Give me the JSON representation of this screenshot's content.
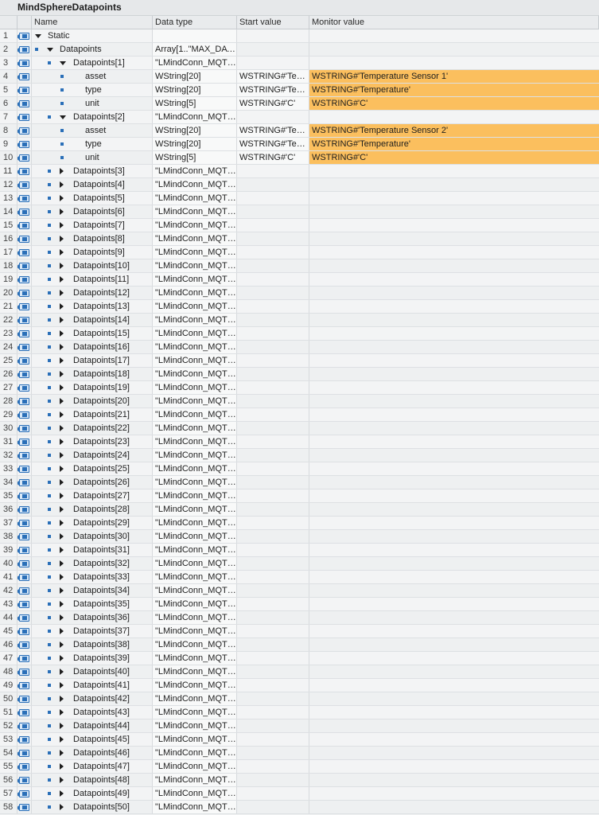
{
  "title": "MindSphereDatapoints",
  "columns": {
    "name": "Name",
    "type": "Data type",
    "start": "Start value",
    "monitor": "Monitor value"
  },
  "colors": {
    "monitor_highlight": "#fbbf5e",
    "icon_blue": "#2a6fb8"
  },
  "rows": [
    {
      "num": "1",
      "name": "Static",
      "type": "",
      "start": "",
      "monitor": "",
      "level": 0,
      "expand": "down",
      "bullet": false
    },
    {
      "num": "2",
      "name": "Datapoints",
      "type": "Array[1..\"MAX_DAT...",
      "start": "",
      "monitor": "",
      "level": 1,
      "expand": "down",
      "bullet": true
    },
    {
      "num": "3",
      "name": "Datapoints[1]",
      "type": "\"LMindConn_MQTT...",
      "start": "",
      "monitor": "",
      "level": 2,
      "expand": "down",
      "bullet": true
    },
    {
      "num": "4",
      "name": "asset",
      "type": "WString[20]",
      "start": "WSTRING#'Tem...",
      "monitor": "WSTRING#'Temperature Sensor 1'",
      "level": 3,
      "expand": "",
      "bullet": true
    },
    {
      "num": "5",
      "name": "type",
      "type": "WString[20]",
      "start": "WSTRING#'Tem...",
      "monitor": "WSTRING#'Temperature'",
      "level": 3,
      "expand": "",
      "bullet": true
    },
    {
      "num": "6",
      "name": "unit",
      "type": "WString[5]",
      "start": "WSTRING#'C'",
      "monitor": "WSTRING#'C'",
      "level": 3,
      "expand": "",
      "bullet": true
    },
    {
      "num": "7",
      "name": "Datapoints[2]",
      "type": "\"LMindConn_MQTT...",
      "start": "",
      "monitor": "",
      "level": 2,
      "expand": "down",
      "bullet": true
    },
    {
      "num": "8",
      "name": "asset",
      "type": "WString[20]",
      "start": "WSTRING#'Tem...",
      "monitor": "WSTRING#'Temperature Sensor 2'",
      "level": 3,
      "expand": "",
      "bullet": true
    },
    {
      "num": "9",
      "name": "type",
      "type": "WString[20]",
      "start": "WSTRING#'Tem...",
      "monitor": "WSTRING#'Temperature'",
      "level": 3,
      "expand": "",
      "bullet": true
    },
    {
      "num": "10",
      "name": "unit",
      "type": "WString[5]",
      "start": "WSTRING#'C'",
      "monitor": "WSTRING#'C'",
      "level": 3,
      "expand": "",
      "bullet": true
    },
    {
      "num": "11",
      "name": "Datapoints[3]",
      "type": "\"LMindConn_MQTT...",
      "start": "",
      "monitor": "",
      "level": 2,
      "expand": "right",
      "bullet": true
    },
    {
      "num": "12",
      "name": "Datapoints[4]",
      "type": "\"LMindConn_MQTT...",
      "start": "",
      "monitor": "",
      "level": 2,
      "expand": "right",
      "bullet": true
    },
    {
      "num": "13",
      "name": "Datapoints[5]",
      "type": "\"LMindConn_MQTT...",
      "start": "",
      "monitor": "",
      "level": 2,
      "expand": "right",
      "bullet": true
    },
    {
      "num": "14",
      "name": "Datapoints[6]",
      "type": "\"LMindConn_MQTT...",
      "start": "",
      "monitor": "",
      "level": 2,
      "expand": "right",
      "bullet": true
    },
    {
      "num": "15",
      "name": "Datapoints[7]",
      "type": "\"LMindConn_MQTT...",
      "start": "",
      "monitor": "",
      "level": 2,
      "expand": "right",
      "bullet": true
    },
    {
      "num": "16",
      "name": "Datapoints[8]",
      "type": "\"LMindConn_MQTT...",
      "start": "",
      "monitor": "",
      "level": 2,
      "expand": "right",
      "bullet": true
    },
    {
      "num": "17",
      "name": "Datapoints[9]",
      "type": "\"LMindConn_MQTT...",
      "start": "",
      "monitor": "",
      "level": 2,
      "expand": "right",
      "bullet": true
    },
    {
      "num": "18",
      "name": "Datapoints[10]",
      "type": "\"LMindConn_MQTT...",
      "start": "",
      "monitor": "",
      "level": 2,
      "expand": "right",
      "bullet": true
    },
    {
      "num": "19",
      "name": "Datapoints[11]",
      "type": "\"LMindConn_MQTT...",
      "start": "",
      "monitor": "",
      "level": 2,
      "expand": "right",
      "bullet": true
    },
    {
      "num": "20",
      "name": "Datapoints[12]",
      "type": "\"LMindConn_MQTT...",
      "start": "",
      "monitor": "",
      "level": 2,
      "expand": "right",
      "bullet": true
    },
    {
      "num": "21",
      "name": "Datapoints[13]",
      "type": "\"LMindConn_MQTT...",
      "start": "",
      "monitor": "",
      "level": 2,
      "expand": "right",
      "bullet": true
    },
    {
      "num": "22",
      "name": "Datapoints[14]",
      "type": "\"LMindConn_MQTT...",
      "start": "",
      "monitor": "",
      "level": 2,
      "expand": "right",
      "bullet": true
    },
    {
      "num": "23",
      "name": "Datapoints[15]",
      "type": "\"LMindConn_MQTT...",
      "start": "",
      "monitor": "",
      "level": 2,
      "expand": "right",
      "bullet": true
    },
    {
      "num": "24",
      "name": "Datapoints[16]",
      "type": "\"LMindConn_MQTT...",
      "start": "",
      "monitor": "",
      "level": 2,
      "expand": "right",
      "bullet": true
    },
    {
      "num": "25",
      "name": "Datapoints[17]",
      "type": "\"LMindConn_MQTT...",
      "start": "",
      "monitor": "",
      "level": 2,
      "expand": "right",
      "bullet": true
    },
    {
      "num": "26",
      "name": "Datapoints[18]",
      "type": "\"LMindConn_MQTT...",
      "start": "",
      "monitor": "",
      "level": 2,
      "expand": "right",
      "bullet": true
    },
    {
      "num": "27",
      "name": "Datapoints[19]",
      "type": "\"LMindConn_MQTT...",
      "start": "",
      "monitor": "",
      "level": 2,
      "expand": "right",
      "bullet": true
    },
    {
      "num": "28",
      "name": "Datapoints[20]",
      "type": "\"LMindConn_MQTT...",
      "start": "",
      "monitor": "",
      "level": 2,
      "expand": "right",
      "bullet": true
    },
    {
      "num": "29",
      "name": "Datapoints[21]",
      "type": "\"LMindConn_MQTT...",
      "start": "",
      "monitor": "",
      "level": 2,
      "expand": "right",
      "bullet": true
    },
    {
      "num": "30",
      "name": "Datapoints[22]",
      "type": "\"LMindConn_MQTT...",
      "start": "",
      "monitor": "",
      "level": 2,
      "expand": "right",
      "bullet": true
    },
    {
      "num": "31",
      "name": "Datapoints[23]",
      "type": "\"LMindConn_MQTT...",
      "start": "",
      "monitor": "",
      "level": 2,
      "expand": "right",
      "bullet": true
    },
    {
      "num": "32",
      "name": "Datapoints[24]",
      "type": "\"LMindConn_MQTT...",
      "start": "",
      "monitor": "",
      "level": 2,
      "expand": "right",
      "bullet": true
    },
    {
      "num": "33",
      "name": "Datapoints[25]",
      "type": "\"LMindConn_MQTT...",
      "start": "",
      "monitor": "",
      "level": 2,
      "expand": "right",
      "bullet": true
    },
    {
      "num": "34",
      "name": "Datapoints[26]",
      "type": "\"LMindConn_MQTT...",
      "start": "",
      "monitor": "",
      "level": 2,
      "expand": "right",
      "bullet": true
    },
    {
      "num": "35",
      "name": "Datapoints[27]",
      "type": "\"LMindConn_MQTT...",
      "start": "",
      "monitor": "",
      "level": 2,
      "expand": "right",
      "bullet": true
    },
    {
      "num": "36",
      "name": "Datapoints[28]",
      "type": "\"LMindConn_MQTT...",
      "start": "",
      "monitor": "",
      "level": 2,
      "expand": "right",
      "bullet": true
    },
    {
      "num": "37",
      "name": "Datapoints[29]",
      "type": "\"LMindConn_MQTT...",
      "start": "",
      "monitor": "",
      "level": 2,
      "expand": "right",
      "bullet": true
    },
    {
      "num": "38",
      "name": "Datapoints[30]",
      "type": "\"LMindConn_MQTT...",
      "start": "",
      "monitor": "",
      "level": 2,
      "expand": "right",
      "bullet": true
    },
    {
      "num": "39",
      "name": "Datapoints[31]",
      "type": "\"LMindConn_MQTT...",
      "start": "",
      "monitor": "",
      "level": 2,
      "expand": "right",
      "bullet": true
    },
    {
      "num": "40",
      "name": "Datapoints[32]",
      "type": "\"LMindConn_MQTT...",
      "start": "",
      "monitor": "",
      "level": 2,
      "expand": "right",
      "bullet": true
    },
    {
      "num": "41",
      "name": "Datapoints[33]",
      "type": "\"LMindConn_MQTT...",
      "start": "",
      "monitor": "",
      "level": 2,
      "expand": "right",
      "bullet": true
    },
    {
      "num": "42",
      "name": "Datapoints[34]",
      "type": "\"LMindConn_MQTT...",
      "start": "",
      "monitor": "",
      "level": 2,
      "expand": "right",
      "bullet": true
    },
    {
      "num": "43",
      "name": "Datapoints[35]",
      "type": "\"LMindConn_MQTT...",
      "start": "",
      "monitor": "",
      "level": 2,
      "expand": "right",
      "bullet": true
    },
    {
      "num": "44",
      "name": "Datapoints[36]",
      "type": "\"LMindConn_MQTT...",
      "start": "",
      "monitor": "",
      "level": 2,
      "expand": "right",
      "bullet": true
    },
    {
      "num": "45",
      "name": "Datapoints[37]",
      "type": "\"LMindConn_MQTT...",
      "start": "",
      "monitor": "",
      "level": 2,
      "expand": "right",
      "bullet": true
    },
    {
      "num": "46",
      "name": "Datapoints[38]",
      "type": "\"LMindConn_MQTT...",
      "start": "",
      "monitor": "",
      "level": 2,
      "expand": "right",
      "bullet": true
    },
    {
      "num": "47",
      "name": "Datapoints[39]",
      "type": "\"LMindConn_MQTT...",
      "start": "",
      "monitor": "",
      "level": 2,
      "expand": "right",
      "bullet": true
    },
    {
      "num": "48",
      "name": "Datapoints[40]",
      "type": "\"LMindConn_MQTT...",
      "start": "",
      "monitor": "",
      "level": 2,
      "expand": "right",
      "bullet": true
    },
    {
      "num": "49",
      "name": "Datapoints[41]",
      "type": "\"LMindConn_MQTT...",
      "start": "",
      "monitor": "",
      "level": 2,
      "expand": "right",
      "bullet": true
    },
    {
      "num": "50",
      "name": "Datapoints[42]",
      "type": "\"LMindConn_MQTT...",
      "start": "",
      "monitor": "",
      "level": 2,
      "expand": "right",
      "bullet": true
    },
    {
      "num": "51",
      "name": "Datapoints[43]",
      "type": "\"LMindConn_MQTT...",
      "start": "",
      "monitor": "",
      "level": 2,
      "expand": "right",
      "bullet": true
    },
    {
      "num": "52",
      "name": "Datapoints[44]",
      "type": "\"LMindConn_MQTT...",
      "start": "",
      "monitor": "",
      "level": 2,
      "expand": "right",
      "bullet": true
    },
    {
      "num": "53",
      "name": "Datapoints[45]",
      "type": "\"LMindConn_MQTT...",
      "start": "",
      "monitor": "",
      "level": 2,
      "expand": "right",
      "bullet": true
    },
    {
      "num": "54",
      "name": "Datapoints[46]",
      "type": "\"LMindConn_MQTT...",
      "start": "",
      "monitor": "",
      "level": 2,
      "expand": "right",
      "bullet": true
    },
    {
      "num": "55",
      "name": "Datapoints[47]",
      "type": "\"LMindConn_MQTT...",
      "start": "",
      "monitor": "",
      "level": 2,
      "expand": "right",
      "bullet": true
    },
    {
      "num": "56",
      "name": "Datapoints[48]",
      "type": "\"LMindConn_MQTT...",
      "start": "",
      "monitor": "",
      "level": 2,
      "expand": "right",
      "bullet": true
    },
    {
      "num": "57",
      "name": "Datapoints[49]",
      "type": "\"LMindConn_MQTT...",
      "start": "",
      "monitor": "",
      "level": 2,
      "expand": "right",
      "bullet": true
    },
    {
      "num": "58",
      "name": "Datapoints[50]",
      "type": "\"LMindConn_MQTT...",
      "start": "",
      "monitor": "",
      "level": 2,
      "expand": "right",
      "bullet": true
    }
  ]
}
